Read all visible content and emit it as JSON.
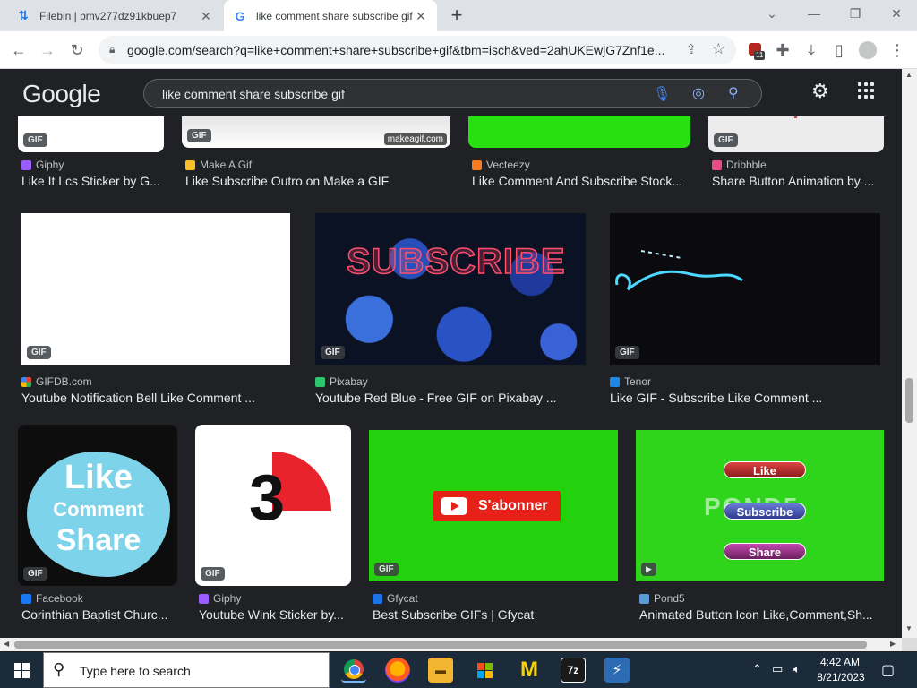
{
  "browser": {
    "tabs": [
      {
        "title": "Filebin | bmv277dz91kbuep7",
        "favicon": "filebin-arrows-icon",
        "active": false
      },
      {
        "title": "like comment share subscribe gif",
        "favicon": "google-g-icon",
        "active": true
      }
    ],
    "url": "google.com/search?q=like+comment+share+subscribe+gif&tbm=isch&ved=2ahUKEwjG7Znf1e...",
    "extension_badge": "11"
  },
  "google": {
    "logo": "Google",
    "query": "like comment share subscribe gif"
  },
  "results": {
    "row1": [
      {
        "source": "Giphy",
        "title": "Like It Lcs Sticker by G...",
        "badge": "GIF",
        "fav_color": "#9b5cff"
      },
      {
        "source": "Make A Gif",
        "title": "Like Subscribe Outro on Make a GIF",
        "badge": "GIF",
        "watermark": "makeagif.com",
        "fav_color": "#f6c026"
      },
      {
        "source": "Vecteezy",
        "title": "Like Comment And Subscribe Stock...",
        "fav_color": "#f57c20"
      },
      {
        "source": "Dribbble",
        "title": "Share Button Animation by ...",
        "badge": "GIF",
        "fav_color": "#ea4c89"
      }
    ],
    "row2": [
      {
        "source": "GIFDB.com",
        "title": "Youtube Notification Bell Like Comment ...",
        "badge": "GIF",
        "fav_color": "#e34234"
      },
      {
        "source": "Pixabay",
        "title": "Youtube Red Blue - Free GIF on Pixabay ...",
        "badge": "GIF",
        "art_text": "SUBSCRIBE",
        "fav_color": "#2ec66d"
      },
      {
        "source": "Tenor",
        "title": "Like GIF - Subscribe Like Comment ...",
        "badge": "GIF",
        "fav_color": "#1e88e5"
      }
    ],
    "row3": [
      {
        "source": "Facebook",
        "title": "Corinthian Baptist Churc...",
        "badge": "GIF",
        "art": [
          "Like",
          "Comment",
          "Share"
        ],
        "fav_color": "#1877f2"
      },
      {
        "source": "Giphy",
        "title": "Youtube Wink Sticker by...",
        "badge": "GIF",
        "art": "3",
        "fav_color": "#9b5cff"
      },
      {
        "source": "Gfycat",
        "title": "Best Subscribe GIFs | Gfycat",
        "badge": "GIF",
        "art": "S'abonner",
        "fav_color": "#1a73e8"
      },
      {
        "source": "Pond5",
        "title": "Animated Button Icon Like,Comment,Sh...",
        "art": [
          "Like",
          "Subscribe",
          "Share"
        ],
        "watermark": "POND5",
        "fav_color": "#5b9bd5"
      }
    ]
  },
  "taskbar": {
    "search_placeholder": "Type here to search",
    "time": "4:42 AM",
    "date": "8/21/2023"
  }
}
